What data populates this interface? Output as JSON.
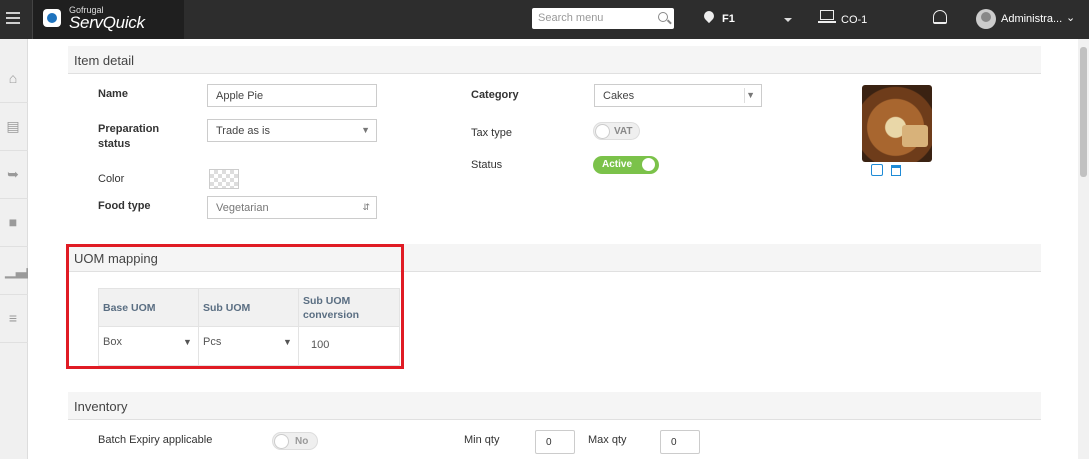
{
  "header": {
    "logo_small": "Gofrugal",
    "logo_big": "ServQuick",
    "search_placeholder": "Search menu",
    "location": "F1",
    "counter": "CO-1",
    "user": "Administra..."
  },
  "sidebar": {
    "icons": [
      "home-icon",
      "book-icon",
      "cart-icon",
      "store-icon",
      "chart-icon",
      "sliders-icon"
    ]
  },
  "item_detail": {
    "title": "Item detail",
    "name_label": "Name",
    "name_value": "Apple Pie",
    "prep_label_1": "Preparation",
    "prep_label_2": "status",
    "prep_value": "Trade as is",
    "color_label": "Color",
    "food_type_label": "Food type",
    "food_type_value": "Vegetarian",
    "category_label": "Category",
    "category_value": "Cakes",
    "tax_type_label": "Tax type",
    "tax_type_value": "VAT",
    "status_label": "Status",
    "status_value": "Active"
  },
  "uom": {
    "title": "UOM mapping",
    "headers": [
      "Base UOM",
      "Sub UOM",
      "Sub UOM conversion"
    ],
    "row": [
      "Box",
      "Pcs",
      "100"
    ]
  },
  "inventory": {
    "title": "Inventory",
    "batch_label": "Batch Expiry applicable",
    "batch_value": "No",
    "min_label": "Min qty",
    "min_value": "0",
    "max_label": "Max qty",
    "max_value": "0"
  },
  "colors": {
    "topbar": "#2d2d2d",
    "active_toggle": "#7bc24a",
    "highlight": "#e01b24",
    "link_icon": "#1f8bd6"
  }
}
